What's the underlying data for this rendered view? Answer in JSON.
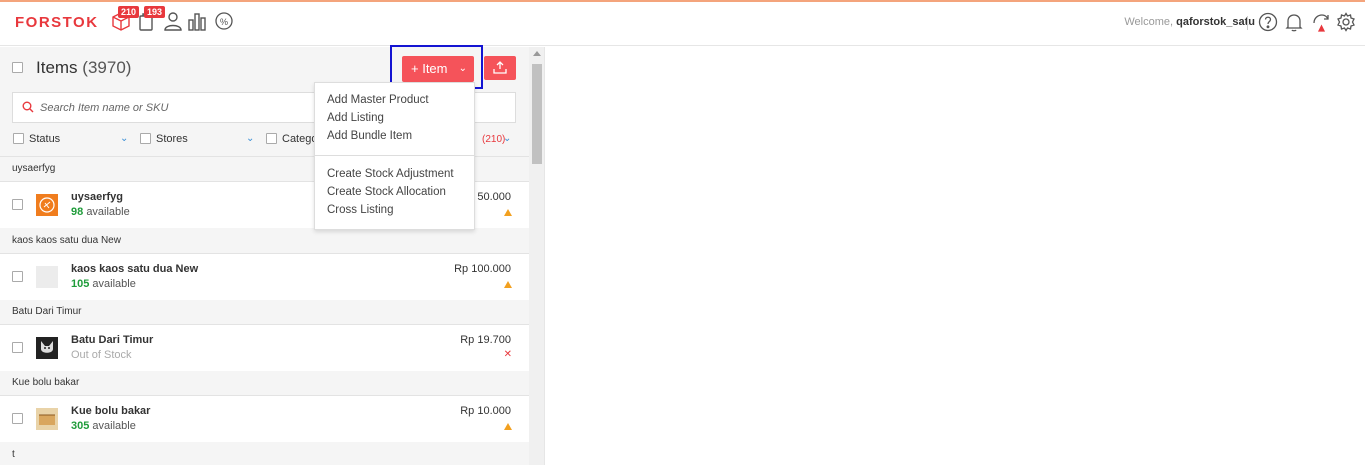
{
  "header": {
    "logo": "FORSTOK",
    "badges": {
      "orders": "210",
      "shipments": "193"
    },
    "welcome_prefix": "Welcome,",
    "username": "qaforstok_satu"
  },
  "items_panel": {
    "title": "Items",
    "count": "(3970)",
    "add_button_label": "+ Item",
    "search_placeholder": "Search Item name or SKU",
    "filters": {
      "status": "Status",
      "stores": "Stores",
      "category": "Catego",
      "count": "(210)"
    }
  },
  "dropdown": {
    "items": [
      "Add Master Product",
      "Add Listing",
      "Add Bundle Item"
    ],
    "items2": [
      "Create Stock Adjustment",
      "Create Stock Allocation",
      "Cross Listing"
    ]
  },
  "rows": [
    {
      "group": "uysaerfyg",
      "name": "uysaerfyg",
      "qty": "98",
      "stock_suffix": "available",
      "price": "50.000",
      "status": "warning"
    },
    {
      "group": "kaos kaos satu dua New",
      "name": "kaos kaos satu dua New",
      "qty": "105",
      "stock_suffix": "available",
      "price": "Rp 100.000",
      "status": "warning"
    },
    {
      "group": "Batu Dari Timur",
      "name": "Batu Dari Timur",
      "stock_text": "Out of Stock",
      "price": "Rp 19.700",
      "status": "error"
    },
    {
      "group": "Kue bolu bakar",
      "name": "Kue bolu bakar",
      "qty": "305",
      "stock_suffix": "available",
      "price": "Rp 10.000",
      "status": "warning"
    }
  ],
  "trailing_group": "t",
  "colors": {
    "brand": "#e8383d",
    "button": "#f5535a",
    "available": "#1f9c3a",
    "warning": "#f2a01f",
    "highlight": "#1414d2"
  }
}
